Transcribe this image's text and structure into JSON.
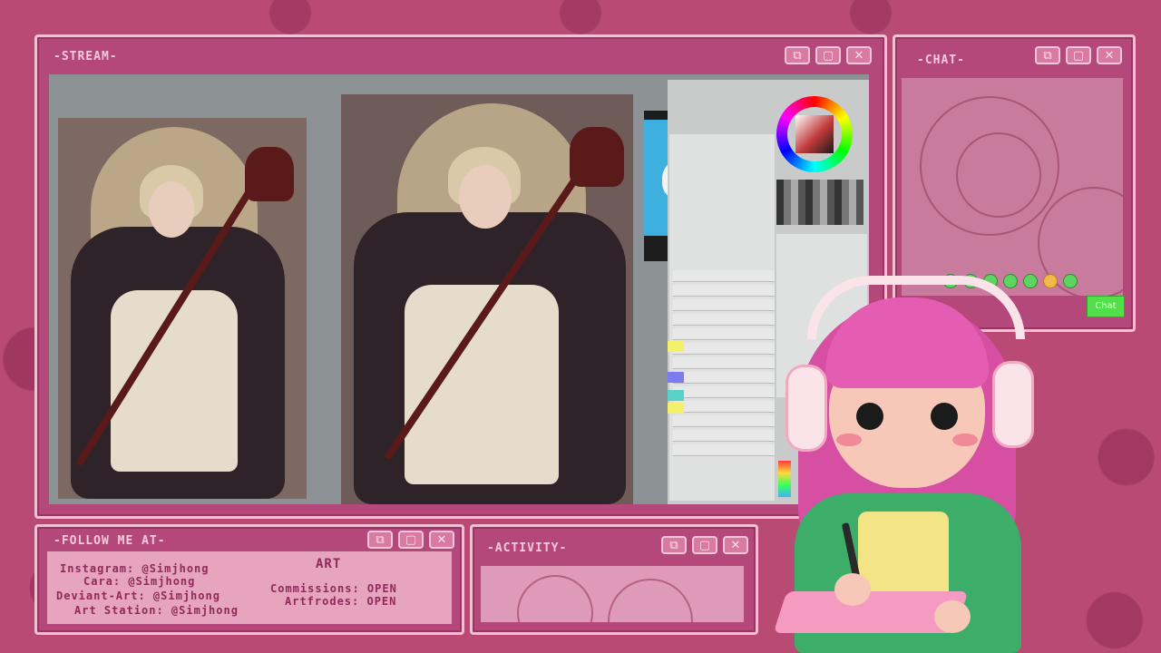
{
  "stream": {
    "title": "-STREAM-"
  },
  "chat": {
    "title": "-CHAT-",
    "button_label": "Chat"
  },
  "follow": {
    "title": "-FOLLOW ME AT-",
    "heading": "ART",
    "line1": "Instagram: @Simjhong",
    "line2": "Cara: @Simjhong",
    "line3": "Deviant-Art: @Simjhong",
    "line4": "Art Station: @Simjhong",
    "status1": "Commissions: OPEN",
    "status2": "Artfrodes: OPEN"
  },
  "activity": {
    "title": "-ACTIVITY-"
  },
  "icons": {
    "restore": "⧉",
    "maximize": "▢",
    "close": "✕"
  },
  "colors": {
    "frame": "#b84a74",
    "panel_border": "#f3bfd4",
    "chat_button": "#52e04a"
  }
}
